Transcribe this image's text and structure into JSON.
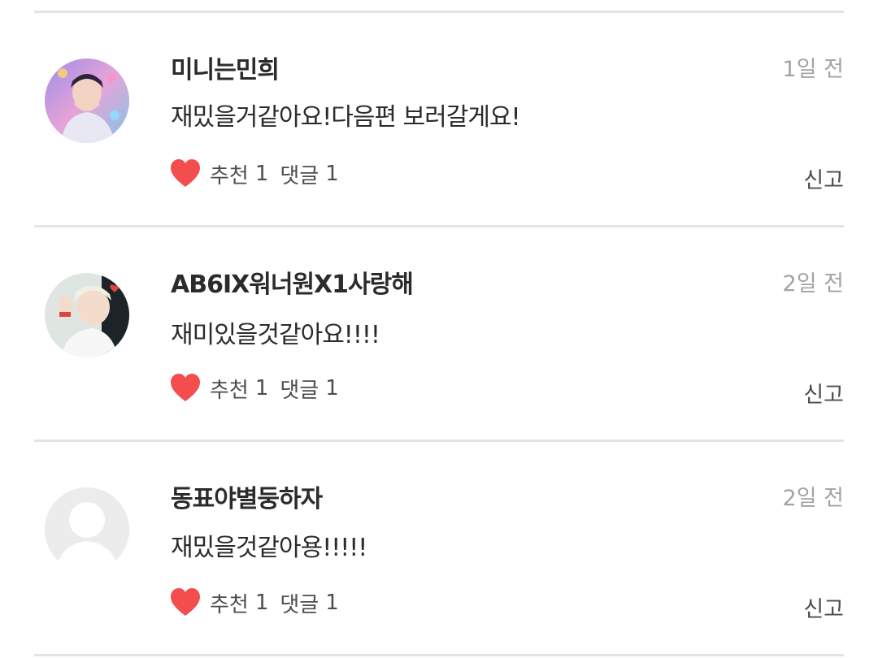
{
  "comments": [
    {
      "author": "미니는민희",
      "time": "1일 전",
      "text": "재밌을거같아요!다음편 보러갈게요!",
      "like_label": "추천",
      "like_count": "1",
      "reply_label": "댓글",
      "reply_count": "1",
      "report_label": "신고",
      "avatar": "profile-photo"
    },
    {
      "author": "AB6IX워너원X1사랑해",
      "time": "2일 전",
      "text": "재미있을것같아요!!!!",
      "like_label": "추천",
      "like_count": "1",
      "reply_label": "댓글",
      "reply_count": "1",
      "report_label": "신고",
      "avatar": "profile-photo"
    },
    {
      "author": "동표야별둥하자",
      "time": "2일 전",
      "text": "재밌을것같아용!!!!!",
      "like_label": "추천",
      "like_count": "1",
      "reply_label": "댓글",
      "reply_count": "1",
      "report_label": "신고",
      "avatar": "default-avatar"
    }
  ],
  "colors": {
    "heart": "#f44d4d",
    "divider": "#e4e4e4",
    "text": "#2b2b2b",
    "muted": "#a3a3a3"
  }
}
